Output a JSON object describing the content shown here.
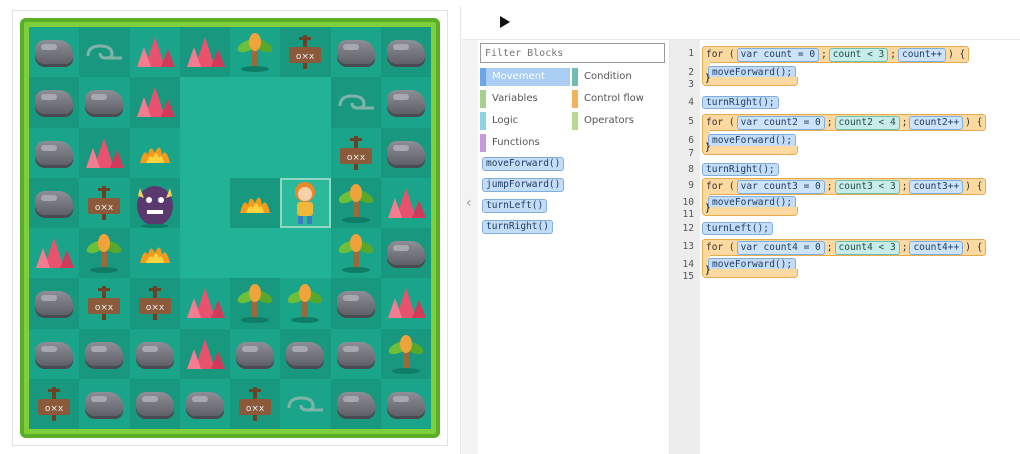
{
  "toolbox": {
    "filter_placeholder": "Filter Blocks",
    "categories": [
      {
        "label": "Movement",
        "color": "#6aa7e8",
        "selected": true
      },
      {
        "label": "Condition",
        "color": "#6fbdb4"
      },
      {
        "label": "Variables",
        "color": "#a8cf8e"
      },
      {
        "label": "Control flow",
        "color": "#f2b35e"
      },
      {
        "label": "Logic",
        "color": "#8fd4e6"
      },
      {
        "label": "Operators",
        "color": "#b5d98e"
      },
      {
        "label": "Functions",
        "color": "#c79ae0"
      }
    ],
    "blocks": [
      "moveForward()",
      "jumpForward()",
      "turnLeft()",
      "turnRight()"
    ]
  },
  "editor": {
    "line_numbers": [
      "1",
      "2",
      "3",
      "4",
      "5",
      "6",
      "7",
      "8",
      "9",
      "10",
      "11",
      "12",
      "13",
      "14",
      "15"
    ],
    "loops": [
      {
        "kw": "for",
        "open": "(",
        "var": "var",
        "name": "count",
        "assign": "= 0",
        "sep1": ";",
        "cond": "count < 3",
        "sep2": ";",
        "inc": "count++",
        "close": ")",
        "brace": "{",
        "body": "moveForward();"
      },
      {
        "kw": "for",
        "open": "(",
        "var": "var",
        "name": "count2",
        "assign": "= 0",
        "sep1": ";",
        "cond": "count2 < 4",
        "sep2": ";",
        "inc": "count2++",
        "close": ")",
        "brace": "{",
        "body": "moveForward();"
      },
      {
        "kw": "for",
        "open": "(",
        "var": "var",
        "name": "count3",
        "assign": "= 0",
        "sep1": ";",
        "cond": "count3 < 3",
        "sep2": ";",
        "inc": "count3++",
        "close": ")",
        "brace": "{",
        "body": "moveForward();"
      },
      {
        "kw": "for",
        "open": "(",
        "var": "var",
        "name": "count4",
        "assign": "= 0",
        "sep1": ";",
        "cond": "count4 < 3",
        "sep2": ";",
        "inc": "count4++",
        "close": ")",
        "brace": "{",
        "body": "moveForward();"
      }
    ],
    "calls": [
      "turnRight();",
      "turnRight();",
      "turnLeft();"
    ],
    "closing_brace": "}"
  },
  "board": {
    "rows": [
      [
        "rock",
        "swirl",
        "crystal",
        "crystal",
        "palm",
        "sign",
        "rock",
        "rock"
      ],
      [
        "rock",
        "rock",
        "crystal",
        "empty",
        "empty",
        "empty",
        "swirl",
        "rock"
      ],
      [
        "rock",
        "crystal",
        "fire",
        "empty",
        "empty",
        "empty",
        "sign",
        "rock"
      ],
      [
        "rock",
        "sign",
        "monster",
        "empty",
        "fire",
        "hero",
        "palm",
        "crystal"
      ],
      [
        "crystal",
        "palm",
        "fire",
        "empty",
        "empty",
        "empty",
        "palm",
        "rock"
      ],
      [
        "rock",
        "sign",
        "sign",
        "crystal",
        "palm",
        "palm",
        "rock",
        "crystal"
      ],
      [
        "rock",
        "rock",
        "rock",
        "crystal",
        "rock",
        "rock",
        "rock",
        "palm"
      ],
      [
        "sign",
        "rock",
        "rock",
        "rock",
        "sign",
        "swirl",
        "rock",
        "rock"
      ]
    ]
  },
  "colors": {
    "board_border": "#7fcf3b",
    "tile_a": "#1aa58a",
    "tile_b": "#17987f",
    "loop": "#fcd9a0",
    "movement": "#c4dcf6"
  }
}
